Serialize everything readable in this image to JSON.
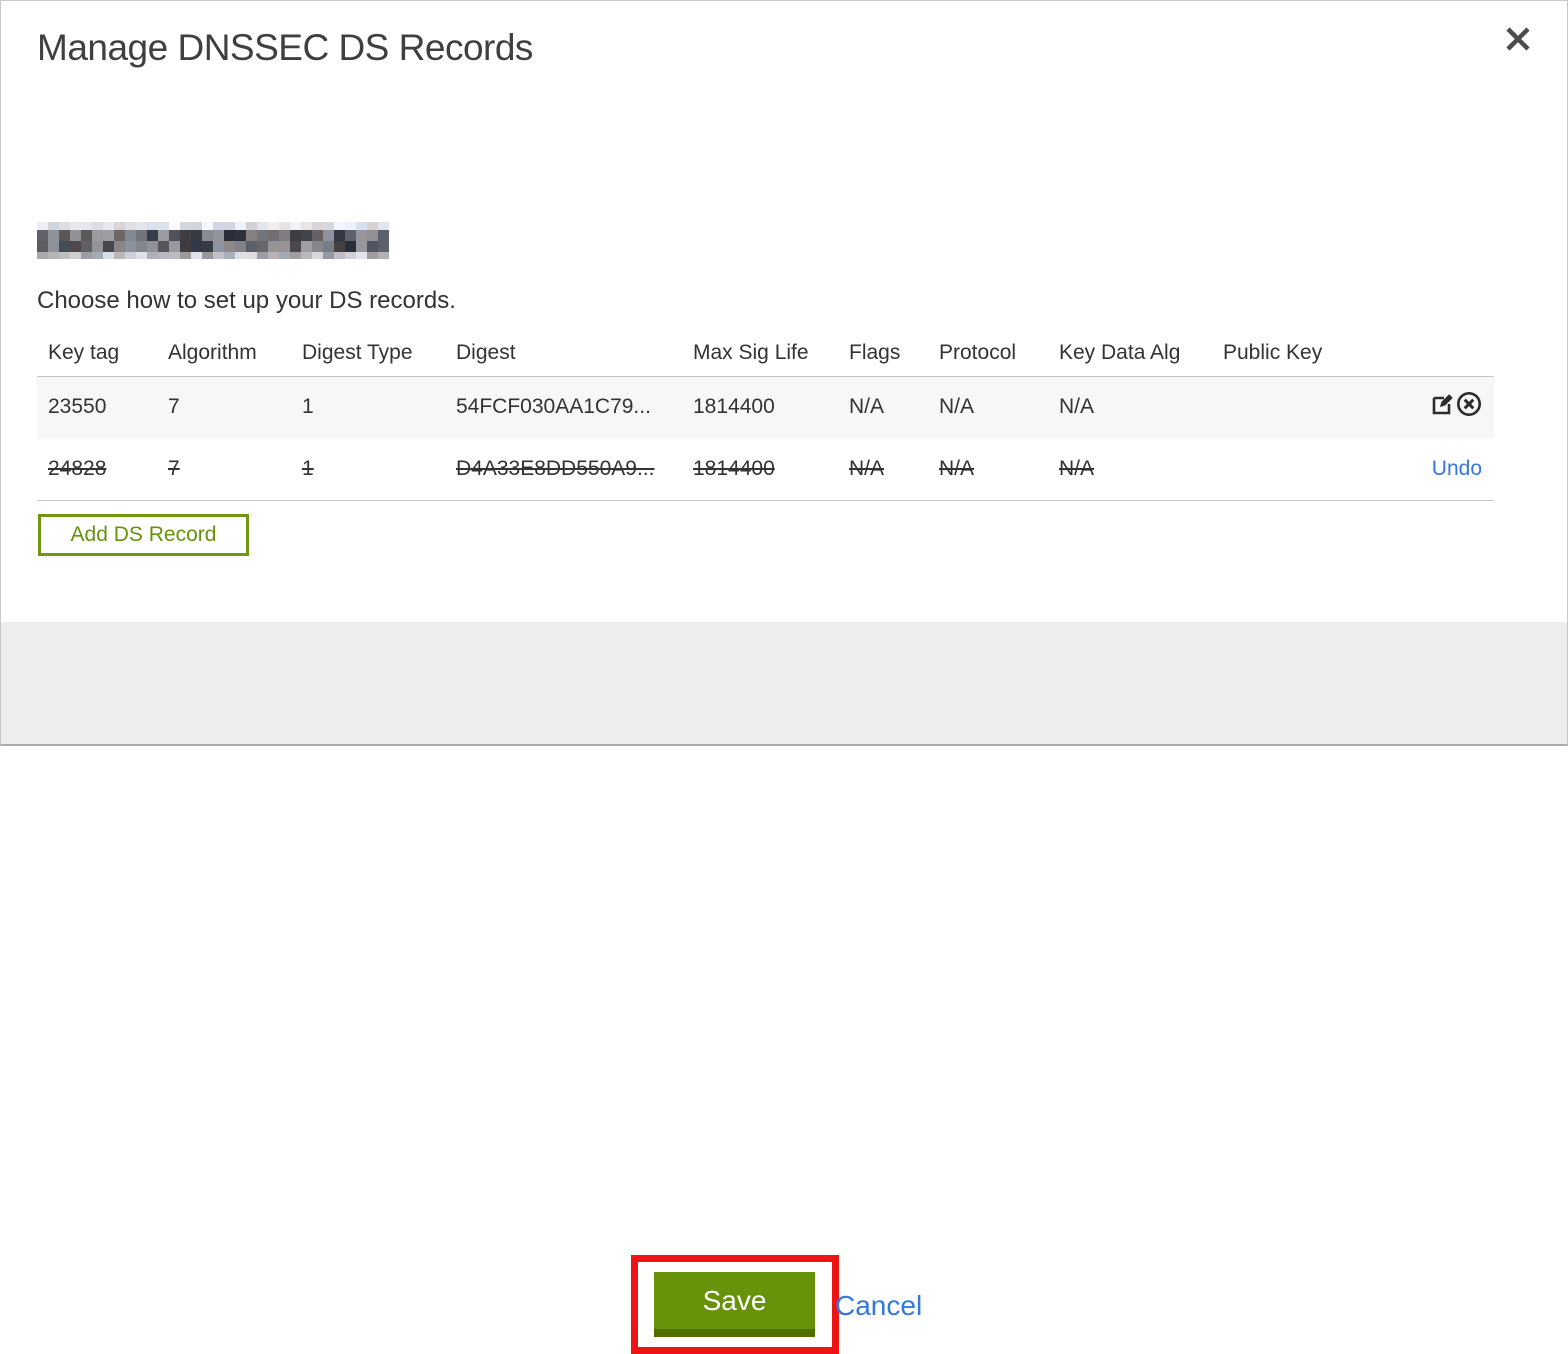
{
  "modal": {
    "title": "Manage DNSSEC DS Records",
    "instruction": "Choose how to set up your DS records.",
    "domain_name_redacted": true
  },
  "table": {
    "columns": [
      "Key tag",
      "Algorithm",
      "Digest Type",
      "Digest",
      "Max Sig Life",
      "Flags",
      "Protocol",
      "Key Data Alg",
      "Public Key"
    ],
    "rows": [
      {
        "cells": [
          "23550",
          "7",
          "1",
          "54FCF030AA1C79...",
          "1814400",
          "N/A",
          "N/A",
          "N/A",
          ""
        ],
        "deleted": false,
        "actions": [
          "edit",
          "delete"
        ]
      },
      {
        "cells": [
          "24828",
          "7",
          "1",
          "D4A33E8DD550A9...",
          "1814400",
          "N/A",
          "N/A",
          "N/A",
          ""
        ],
        "deleted": true,
        "actions": [
          "undo"
        ],
        "undo_label": "Undo"
      }
    ]
  },
  "buttons": {
    "add_ds_record": "Add DS Record",
    "save": "Save",
    "cancel": "Cancel"
  },
  "icons": {
    "close": "close-icon",
    "edit": "edit-icon",
    "delete": "delete-icon"
  },
  "colors": {
    "accent_green": "#679209",
    "accent_green_dark": "#4f7000",
    "green_border": "#6f970f",
    "link_blue": "#3577e0",
    "annotation_red": "#ee1414",
    "footer_bg": "#ededed",
    "row_alt_bg": "#f7f7f7",
    "title_text": "#3f3f3f",
    "body_text": "#333333"
  }
}
